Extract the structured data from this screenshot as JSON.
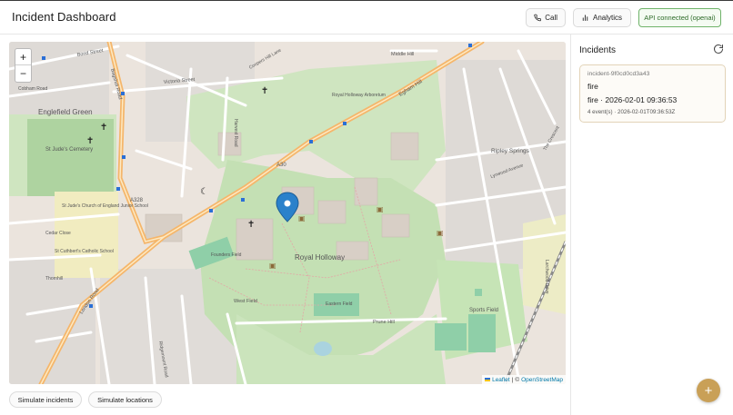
{
  "app": {
    "title": "Incident Dashboard"
  },
  "header": {
    "call_label": "Call",
    "analytics_label": "Analytics",
    "api_status": "API connected (openai)"
  },
  "map": {
    "zoom_in": "+",
    "zoom_out": "−",
    "attribution": {
      "leaflet": "Leaflet",
      "separator": "|",
      "copyright": "©",
      "osm": "OpenStreetMap"
    },
    "labels": {
      "englefield_green": "Englefield Green",
      "st_judes_cemetery": "St Jude's Cemetery",
      "st_judes_school": "St Jude's Church of England Junior School",
      "st_cuthberts": "St Cuthbert's Catholic School",
      "royal_holloway": "Royal Holloway",
      "founders_field": "Founders Field",
      "sports_field": "Sports Field",
      "west_field": "West Field",
      "eastern_field": "Eastern Field",
      "ripley_springs": "Ripley Springs",
      "egham_hill": "Egham Hill",
      "a30": "A30",
      "a328": "A328",
      "bond_street": "Bond Street",
      "middle_hill": "Middle Hill",
      "victoria_street": "Victoria Street",
      "harvest_road": "Harvest Road",
      "prune_hill": "Prune Hill",
      "london_road": "London Road",
      "bagshot_road": "Bagshot Road",
      "coopers_hill": "Coopers Hill Lane",
      "arboretum": "Royal Holloway Arboretum",
      "cobham_road": "Cobham Road",
      "larchwood_drive": "Larchwood Drive",
      "lynwood_avenue": "Lynwood Avenue",
      "thornhill": "Thornhill",
      "cedar_close": "Cedar Close",
      "ridgemount_road": "Ridgemount Road",
      "the_crescent": "The Crescent"
    }
  },
  "actions": {
    "simulate_incidents": "Simulate incidents",
    "simulate_locations": "Simulate locations"
  },
  "sidebar": {
    "title": "Incidents",
    "incidents": [
      {
        "id": "incident-9f0cd0cd3a43",
        "type": "fire",
        "summary": "fire · 2026-02-01 09:36:53",
        "meta": "4 event(s) · 2026-02-01T09:36:53Z"
      }
    ]
  },
  "fab_label": "+",
  "colors": {
    "accent": "#c9a057",
    "api_green": "#2d6a28",
    "marker_blue": "#2a81cb",
    "major_road": "#f5b66b"
  }
}
